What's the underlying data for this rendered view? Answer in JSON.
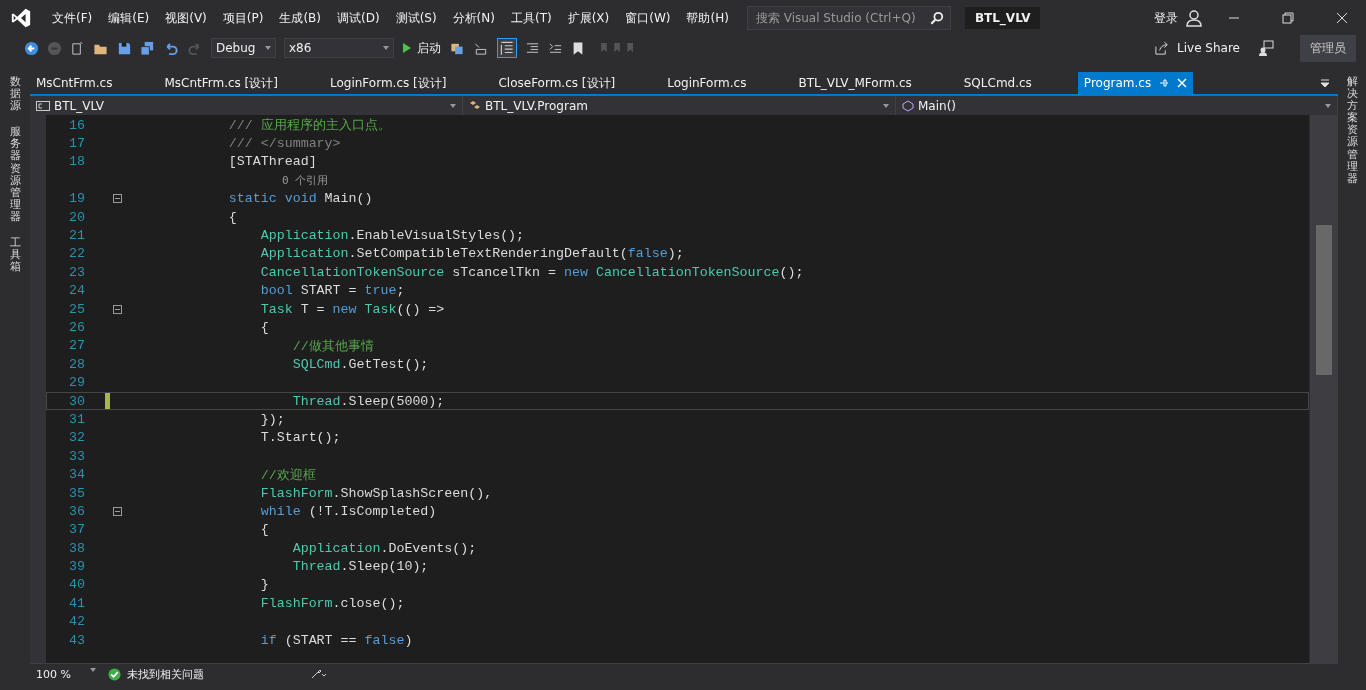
{
  "menu": [
    {
      "label": "文件(F)"
    },
    {
      "label": "编辑(E)"
    },
    {
      "label": "视图(V)"
    },
    {
      "label": "项目(P)"
    },
    {
      "label": "生成(B)"
    },
    {
      "label": "调试(D)"
    },
    {
      "label": "测试(S)"
    },
    {
      "label": "分析(N)"
    },
    {
      "label": "工具(T)"
    },
    {
      "label": "扩展(X)"
    },
    {
      "label": "窗口(W)"
    },
    {
      "label": "帮助(H)"
    }
  ],
  "search": {
    "placeholder": "搜索 Visual Studio (Ctrl+Q)"
  },
  "window": {
    "title": "BTL_VLV"
  },
  "account": {
    "sign_in": "登录",
    "live_share": "Live Share",
    "admin": "管理员"
  },
  "toolbar": {
    "configuration": "Debug",
    "platform": "x86",
    "start": "启动"
  },
  "left_panels": [
    {
      "label": "数据源"
    },
    {
      "label": "服务器资源管理器"
    },
    {
      "label": "工具箱"
    }
  ],
  "right_panels": [
    {
      "label": "解决方案资源管理器"
    }
  ],
  "tabs": [
    {
      "label": "MsCntFrm.cs",
      "selected": false
    },
    {
      "label": "MsCntFrm.cs [设计]",
      "selected": false
    },
    {
      "label": "LoginForm.cs [设计]",
      "selected": false
    },
    {
      "label": "CloseForm.cs [设计]",
      "selected": false
    },
    {
      "label": "LoginForm.cs",
      "selected": false
    },
    {
      "label": "BTL_VLV_MForm.cs",
      "selected": false
    },
    {
      "label": "SQLCmd.cs",
      "selected": false
    },
    {
      "label": "Program.cs",
      "selected": true
    }
  ],
  "nav": {
    "project": "BTL_VLV",
    "type": "BTL_VLV.Program",
    "member": "Main()"
  },
  "lines": [
    {
      "kind": "code",
      "number": "16",
      "fold": false,
      "current": false,
      "tokens": [
        {
          "kind": "doc",
          "text": "        /// "
        },
        {
          "kind": "comment",
          "text": "应用程序的主入口点。"
        }
      ]
    },
    {
      "kind": "code",
      "number": "17",
      "fold": false,
      "current": false,
      "tokens": [
        {
          "kind": "doc",
          "text": "        /// </summary>"
        }
      ]
    },
    {
      "kind": "code",
      "number": "18",
      "fold": false,
      "current": false,
      "tokens": [
        {
          "kind": "plain",
          "text": "        [STAThread]"
        }
      ]
    },
    {
      "kind": "codelens",
      "text": "0 个引用"
    },
    {
      "kind": "code",
      "number": "19",
      "fold": true,
      "current": false,
      "tokens": [
        {
          "kind": "kw",
          "text": "        static void"
        },
        {
          "kind": "plain",
          "text": " Main()"
        }
      ]
    },
    {
      "kind": "code",
      "number": "20",
      "fold": false,
      "current": false,
      "tokens": [
        {
          "kind": "plain",
          "text": "        {"
        }
      ]
    },
    {
      "kind": "code",
      "number": "21",
      "fold": false,
      "current": false,
      "tokens": [
        {
          "kind": "type",
          "text": "            Application"
        },
        {
          "kind": "plain",
          "text": ".EnableVisualStyles();"
        }
      ]
    },
    {
      "kind": "code",
      "number": "22",
      "fold": false,
      "current": false,
      "tokens": [
        {
          "kind": "type",
          "text": "            Application"
        },
        {
          "kind": "plain",
          "text": ".SetCompatibleTextRenderingDefault("
        },
        {
          "kind": "kw",
          "text": "false"
        },
        {
          "kind": "plain",
          "text": ");"
        }
      ]
    },
    {
      "kind": "code",
      "number": "23",
      "fold": false,
      "current": false,
      "tokens": [
        {
          "kind": "type",
          "text": "            CancellationTokenSource"
        },
        {
          "kind": "plain",
          "text": " sTcancelTkn = "
        },
        {
          "kind": "kw",
          "text": "new"
        },
        {
          "kind": "type",
          "text": " CancellationTokenSource"
        },
        {
          "kind": "plain",
          "text": "();"
        }
      ]
    },
    {
      "kind": "code",
      "number": "24",
      "fold": false,
      "current": false,
      "tokens": [
        {
          "kind": "kw",
          "text": "            bool"
        },
        {
          "kind": "plain",
          "text": " START = "
        },
        {
          "kind": "kw",
          "text": "true"
        },
        {
          "kind": "plain",
          "text": ";"
        }
      ]
    },
    {
      "kind": "code",
      "number": "25",
      "fold": true,
      "current": false,
      "tokens": [
        {
          "kind": "type",
          "text": "            Task"
        },
        {
          "kind": "plain",
          "text": " T = "
        },
        {
          "kind": "kw",
          "text": "new"
        },
        {
          "kind": "type",
          "text": " Task"
        },
        {
          "kind": "plain",
          "text": "(() =>"
        }
      ]
    },
    {
      "kind": "code",
      "number": "26",
      "fold": false,
      "current": false,
      "tokens": [
        {
          "kind": "plain",
          "text": "            {"
        }
      ]
    },
    {
      "kind": "code",
      "number": "27",
      "fold": false,
      "current": false,
      "tokens": [
        {
          "kind": "comment",
          "text": "                //做其他事情"
        }
      ]
    },
    {
      "kind": "code",
      "number": "28",
      "fold": false,
      "current": false,
      "tokens": [
        {
          "kind": "type",
          "text": "                SQLCmd"
        },
        {
          "kind": "plain",
          "text": ".GetTest();"
        }
      ]
    },
    {
      "kind": "code",
      "number": "29",
      "fold": false,
      "current": false
    },
    {
      "kind": "code",
      "number": "30",
      "fold": false,
      "current": true,
      "tokens": [
        {
          "kind": "type",
          "text": "                Thread"
        },
        {
          "kind": "plain",
          "text": ".Sleep(5000);"
        }
      ]
    },
    {
      "kind": "code",
      "number": "31",
      "fold": false,
      "current": false,
      "tokens": [
        {
          "kind": "plain",
          "text": "            });"
        }
      ]
    },
    {
      "kind": "code",
      "number": "32",
      "fold": false,
      "current": false,
      "tokens": [
        {
          "kind": "plain",
          "text": "            T.Start();"
        }
      ]
    },
    {
      "kind": "code",
      "number": "33",
      "fold": false,
      "current": false
    },
    {
      "kind": "code",
      "number": "34",
      "fold": false,
      "current": false,
      "tokens": [
        {
          "kind": "comment",
          "text": "            //欢迎框"
        }
      ]
    },
    {
      "kind": "code",
      "number": "35",
      "fold": false,
      "current": false,
      "tokens": [
        {
          "kind": "type",
          "text": "            FlashForm"
        },
        {
          "kind": "plain",
          "text": ".ShowSplashScreen(),"
        }
      ]
    },
    {
      "kind": "code",
      "number": "36",
      "fold": true,
      "current": false,
      "tokens": [
        {
          "kind": "kw",
          "text": "            while"
        },
        {
          "kind": "plain",
          "text": " (!T.IsCompleted)"
        }
      ]
    },
    {
      "kind": "code",
      "number": "37",
      "fold": false,
      "current": false,
      "tokens": [
        {
          "kind": "plain",
          "text": "            {"
        }
      ]
    },
    {
      "kind": "code",
      "number": "38",
      "fold": false,
      "current": false,
      "tokens": [
        {
          "kind": "type",
          "text": "                Application"
        },
        {
          "kind": "plain",
          "text": ".DoEvents();"
        }
      ]
    },
    {
      "kind": "code",
      "number": "39",
      "fold": false,
      "current": false,
      "tokens": [
        {
          "kind": "type",
          "text": "                Thread"
        },
        {
          "kind": "plain",
          "text": ".Sleep(10);"
        }
      ]
    },
    {
      "kind": "code",
      "number": "40",
      "fold": false,
      "current": false,
      "tokens": [
        {
          "kind": "plain",
          "text": "            }"
        }
      ]
    },
    {
      "kind": "code",
      "number": "41",
      "fold": false,
      "current": false,
      "tokens": [
        {
          "kind": "type",
          "text": "            FlashForm"
        },
        {
          "kind": "plain",
          "text": ".close();"
        }
      ]
    },
    {
      "kind": "code",
      "number": "42",
      "fold": false,
      "current": false
    },
    {
      "kind": "code",
      "number": "43",
      "fold": false,
      "current": false,
      "tokens": [
        {
          "kind": "kw",
          "text": "            if"
        },
        {
          "kind": "plain",
          "text": " (START == "
        },
        {
          "kind": "kw",
          "text": "false"
        },
        {
          "kind": "plain",
          "text": ")"
        }
      ]
    }
  ],
  "status": {
    "zoom": "100 %",
    "issues": "未找到相关问题"
  }
}
